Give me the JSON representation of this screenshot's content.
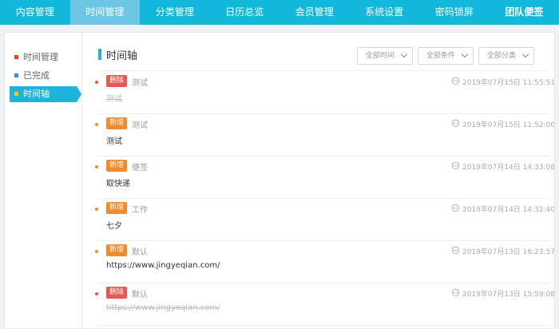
{
  "nav": [
    {
      "label": "内容管理",
      "active": false,
      "bold": false
    },
    {
      "label": "时间管理",
      "active": true,
      "bold": false
    },
    {
      "label": "分类管理",
      "active": false,
      "bold": false
    },
    {
      "label": "日历总览",
      "active": false,
      "bold": false
    },
    {
      "label": "会员管理",
      "active": false,
      "bold": false
    },
    {
      "label": "系统设置",
      "active": false,
      "bold": false
    },
    {
      "label": "密码锁屏",
      "active": false,
      "bold": false
    },
    {
      "label": "团队便签",
      "active": false,
      "bold": true
    }
  ],
  "sidebar": {
    "items": [
      {
        "label": "时间管理",
        "dot_color": "#e8412c",
        "active": false
      },
      {
        "label": "已完成",
        "dot_color": "#3a8ee6",
        "active": false
      },
      {
        "label": "时间轴",
        "dot_color": "#f5c518",
        "active": true
      }
    ]
  },
  "header": {
    "title": "时间轴",
    "filters": [
      "全部时间",
      "全部条件",
      "全部分类"
    ]
  },
  "colors": {
    "accent": "#13b7dc",
    "tag_delete": "#e8564f",
    "tag_new": "#f08c2e"
  },
  "timeline": [
    {
      "tag": "删除",
      "tag_type": "delete",
      "category": "测试",
      "time": "2019年07月15日 11:55:51",
      "body": "测试",
      "strike": true
    },
    {
      "tag": "新增",
      "tag_type": "new",
      "category": "测试",
      "time": "2019年07月15日 11:52:00",
      "body": "测试",
      "strike": false
    },
    {
      "tag": "新增",
      "tag_type": "new",
      "category": "便签",
      "time": "2019年07月14日 14:33:08",
      "body": "取快递",
      "strike": false
    },
    {
      "tag": "新增",
      "tag_type": "new",
      "category": "工作",
      "time": "2019年07月14日 14:32:40",
      "body": "七夕",
      "strike": false
    },
    {
      "tag": "新增",
      "tag_type": "new",
      "category": "默认",
      "time": "2019年07月13日 16:23:57",
      "body": "https://www.jingyeqian.com/",
      "strike": false
    },
    {
      "tag": "删除",
      "tag_type": "delete",
      "category": "默认",
      "time": "2019年07月13日 15:59:08",
      "body": "https://www.jingyeqian.com/",
      "strike": true
    }
  ]
}
